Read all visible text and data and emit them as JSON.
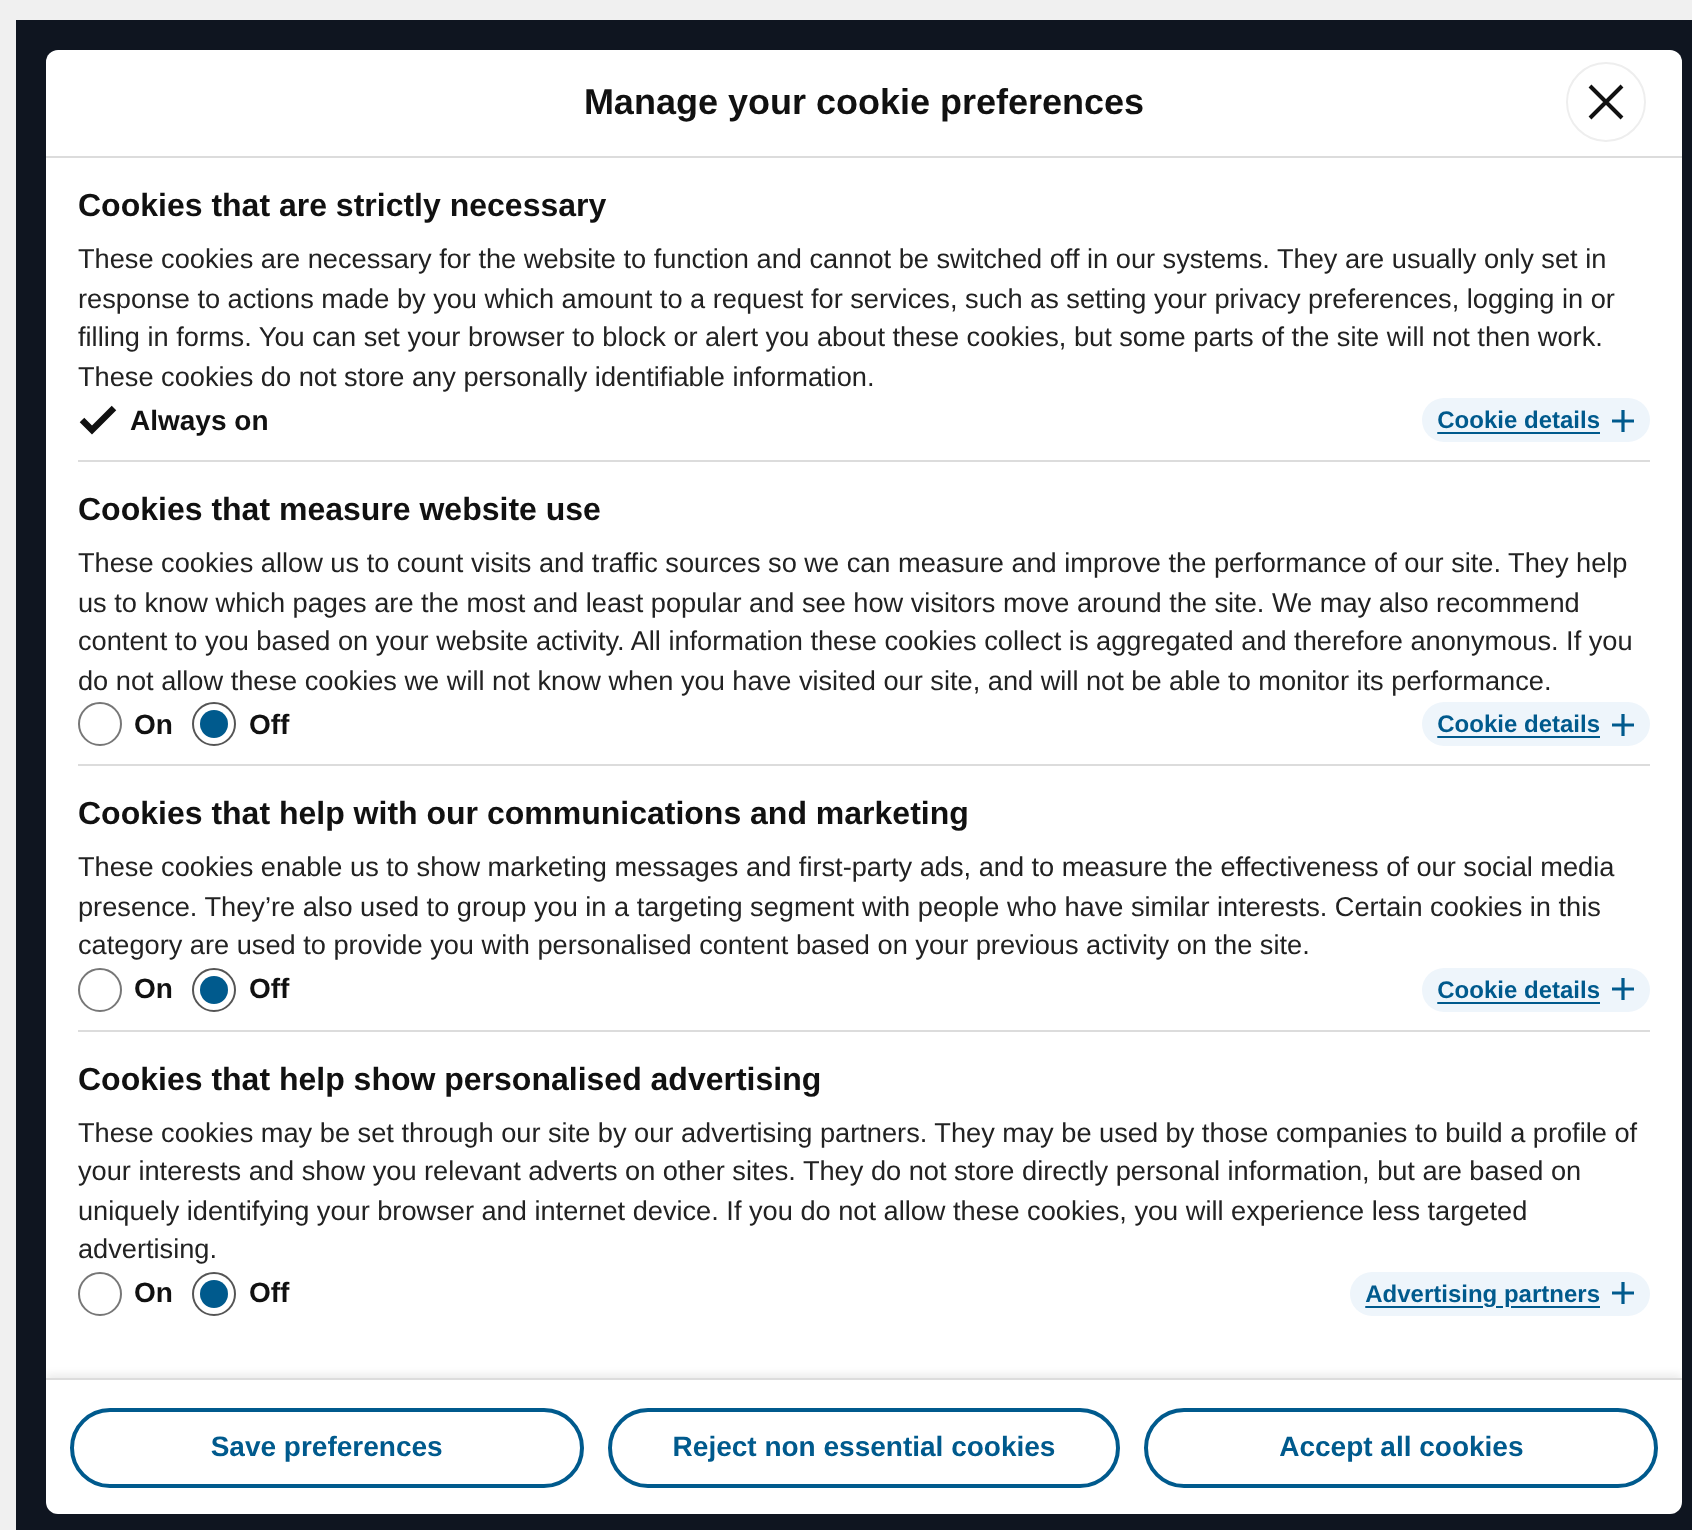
{
  "dialog": {
    "title": "Manage your cookie preferences"
  },
  "sections": [
    {
      "kind": "always",
      "heading": "Cookies that are strictly necessary",
      "text": "These cookies are necessary for the website to function and cannot be switched off in our systems. They are usually only set in response to actions made by you which amount to a request for services, such as setting your privacy preferences, logging in or filling in forms. You can set your browser to block or alert you about these cookies, but some parts of the site will not then work. These cookies do not store any personally identifiable information.",
      "status": "Always on",
      "link": "Cookie details"
    },
    {
      "kind": "radio",
      "heading": "Cookies that measure website use",
      "text": "These cookies allow us to count visits and traffic sources so we can measure and improve the performance of our site. They help us to know which pages are the most and least popular and see how visitors move around the site. We may also recommend content to you based on your website activity. All information these cookies collect is aggregated and therefore anonymous. If you do not allow these cookies we will not know when you have visited our site, and will not be able to monitor its performance.",
      "options": [
        {
          "label": "On",
          "selected": false
        },
        {
          "label": "Off",
          "selected": true
        }
      ],
      "link": "Cookie details"
    },
    {
      "kind": "radio",
      "heading": "Cookies that help with our communications and marketing",
      "text": "These cookies enable us to show marketing messages and first-party ads, and to measure the effectiveness of our social media presence. They’re also used to group you in a targeting segment with people who have similar interests. Certain cookies in this category are used to provide you with personalised content based on your previous activity on the site.",
      "options": [
        {
          "label": "On",
          "selected": false
        },
        {
          "label": "Off",
          "selected": true
        }
      ],
      "link": "Cookie details"
    },
    {
      "kind": "radio",
      "heading": "Cookies that help show personalised advertising",
      "text": "These cookies may be set through our site by our advertising partners. They may be used by those companies to build a profile of your interests and show you relevant adverts on other sites. They do not store directly personal information, but are based on uniquely identifying your browser and internet device. If you do not allow these cookies, you will experience less targeted advertising.",
      "options": [
        {
          "label": "On",
          "selected": false
        },
        {
          "label": "Off",
          "selected": true
        }
      ],
      "link": "Advertising partners"
    }
  ],
  "buttons": [
    "Save preferences",
    "Reject non essential cookies",
    "Accept all cookies"
  ]
}
